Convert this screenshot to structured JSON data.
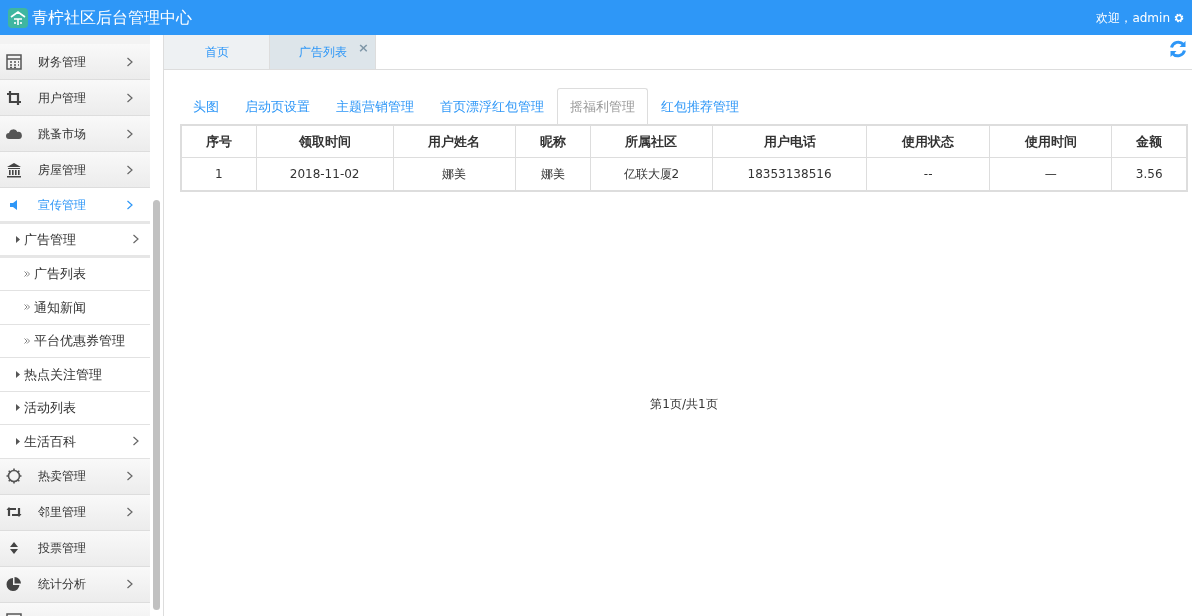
{
  "header": {
    "title": "青柠社区后台管理中心",
    "welcome": "欢迎，admin"
  },
  "sidebar": {
    "items": [
      {
        "label": "财务管理",
        "has_submenu": true,
        "selected": false
      },
      {
        "label": "用户管理",
        "has_submenu": true,
        "selected": false
      },
      {
        "label": "跳蚤市场",
        "has_submenu": true,
        "selected": false
      },
      {
        "label": "房屋管理",
        "has_submenu": true,
        "selected": false
      },
      {
        "label": "宣传管理",
        "has_submenu": true,
        "selected": true,
        "expanded": true,
        "children": [
          {
            "label": "广告管理",
            "has_submenu": true,
            "expanded": true,
            "children": [
              {
                "label": "广告列表"
              },
              {
                "label": "通知新闻"
              },
              {
                "label": "平台优惠券管理"
              }
            ]
          },
          {
            "label": "热点关注管理",
            "has_submenu": false
          },
          {
            "label": "活动列表",
            "has_submenu": false
          },
          {
            "label": "生活百科",
            "has_submenu": true
          }
        ]
      },
      {
        "label": "热卖管理",
        "has_submenu": true,
        "selected": false
      },
      {
        "label": "邻里管理",
        "has_submenu": true,
        "selected": false
      },
      {
        "label": "投票管理",
        "has_submenu": false,
        "selected": false
      },
      {
        "label": "统计分析",
        "has_submenu": true,
        "selected": false
      }
    ]
  },
  "page_tabs": [
    {
      "label": "首页",
      "selected": false
    },
    {
      "label": "广告列表",
      "selected": true,
      "close": "×"
    }
  ],
  "content_tabs": [
    {
      "label": "头图",
      "selected": false
    },
    {
      "label": "启动页设置",
      "selected": false
    },
    {
      "label": "主题营销管理",
      "selected": false
    },
    {
      "label": "首页漂浮红包管理",
      "selected": false
    },
    {
      "label": "摇福利管理",
      "selected": true
    },
    {
      "label": "红包推荐管理",
      "selected": false
    }
  ],
  "table": {
    "columns": [
      "序号",
      "领取时间",
      "用户姓名",
      "昵称",
      "所属社区",
      "用户电话",
      "使用状态",
      "使用时间",
      "金额"
    ],
    "rows": [
      [
        "1",
        "2018-11-02",
        "娜美",
        "娜美",
        "亿联大厦2",
        "18353138516",
        "--",
        "—",
        "3.56"
      ]
    ]
  },
  "pagination": "第1页/共1页"
}
